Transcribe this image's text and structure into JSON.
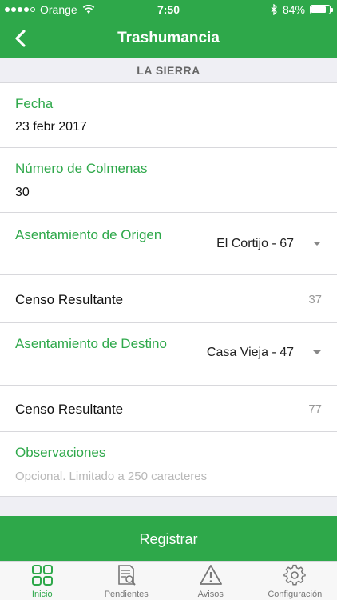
{
  "status": {
    "carrier": "Orange",
    "time": "7:50",
    "battery": "84%",
    "battery_level": 0.84
  },
  "nav": {
    "title": "Trashumancia",
    "back_icon": "chevron-left-icon"
  },
  "section": {
    "title": "LA SIERRA"
  },
  "form": {
    "fecha": {
      "label": "Fecha",
      "value": "23 febr 2017"
    },
    "colmenas": {
      "label": "Número de Colmenas",
      "value": "30"
    },
    "origen": {
      "label": "Asentamiento de Origen",
      "value": "El Cortijo - 67"
    },
    "censo_origen": {
      "label": "Censo Resultante",
      "value": "37"
    },
    "destino": {
      "label": "Asentamiento de Destino",
      "value": "Casa Vieja - 47"
    },
    "censo_destino": {
      "label": "Censo Resultante",
      "value": "77"
    },
    "observaciones": {
      "label": "Observaciones",
      "placeholder": "Opcional. Limitado a 250 caracteres"
    }
  },
  "submit": {
    "label": "Registrar"
  },
  "tabs": [
    {
      "label": "Inicio",
      "icon": "grid-icon",
      "active": true
    },
    {
      "label": "Pendientes",
      "icon": "document-search-icon",
      "active": false
    },
    {
      "label": "Avisos",
      "icon": "warning-icon",
      "active": false
    },
    {
      "label": "Configuración",
      "icon": "gear-icon",
      "active": false
    }
  ],
  "colors": {
    "accent": "#2ea84a",
    "background": "#efeff4",
    "muted": "#999999"
  }
}
